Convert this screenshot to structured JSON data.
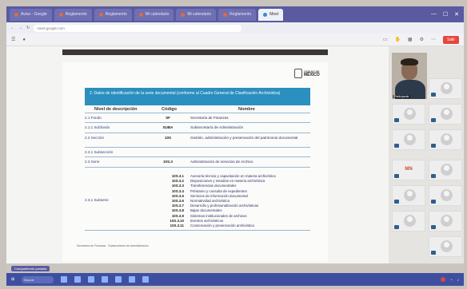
{
  "browser": {
    "tabs": [
      {
        "label": "Aviso - Google"
      },
      {
        "label": "Reglamento"
      },
      {
        "label": "Reglamento"
      },
      {
        "label": "Mi calendario"
      },
      {
        "label": "Mi calendario"
      },
      {
        "label": "Reglamento"
      },
      {
        "label": "Meet",
        "active": true
      }
    ],
    "url": "meet.google.com"
  },
  "toolbar": {
    "leave_label": "Salir"
  },
  "slide": {
    "logo_line1": "CIUDAD DE",
    "logo_line2": "MÉXICO",
    "table_title": "2. Datos de identificación de la serie documental (conforme al Cuadro General de Clasificación Archivística)",
    "headers": {
      "level": "Nivel de descripción",
      "code": "Código",
      "name": "Nombre"
    },
    "rows": [
      {
        "level": "2.1 Fondo",
        "code": "SF",
        "name": "Secretaría de Finanzas"
      },
      {
        "level": "2.1.1 Subfondo",
        "code": "SUBA",
        "name": "Subsecretaría de Administración"
      },
      {
        "level": "2.2 Sección",
        "code": "10S",
        "name": "Gestión, administración y preservación del patrimonio documental"
      },
      {
        "level": "2.2.1 Subsección",
        "code": "",
        "name": ""
      },
      {
        "level": "2.3 Serie",
        "code": "10S.3",
        "name": "Administración de servicios de Archivo"
      },
      {
        "level": "2.3.1 Subserie",
        "code": "",
        "name": ""
      }
    ],
    "subseries_codes": [
      "10S.3.1",
      "10S.3.2",
      "10S.3.3",
      "10S.3.4",
      "10S.3.5",
      "10S.3.6",
      "10S.3.7",
      "10S.3.8",
      "10S.3.9",
      "10S.3.10",
      "10S.3.11"
    ],
    "subseries_names": [
      "Asesoría técnica y capacitación en materia archivística",
      "Disposiciones y estudios en materia archivística",
      "Transferencias documentales",
      "Préstamo y consulta de expedientes",
      "Servicios de información documental",
      "Normatividad archivística",
      "Desarrollo y profesionalización archivísticas",
      "Bajas documentales",
      "Sistemas institucionales de archivos",
      "Eventos archivísticos",
      "Conservación y preservación archivística"
    ],
    "footnote": "Secretaría de Finanzas · Subsecretaría de Administración"
  },
  "participants": {
    "presenter_name": "Participante",
    "initials": "MN"
  },
  "taskbar": {
    "search_label": "Buscar",
    "tray_label": "Compartiendo pantalla"
  },
  "colors": {
    "table_header": "#2b8fbf",
    "taskbar": "#3f4fa0",
    "tabstrip": "#5a5aa0"
  }
}
